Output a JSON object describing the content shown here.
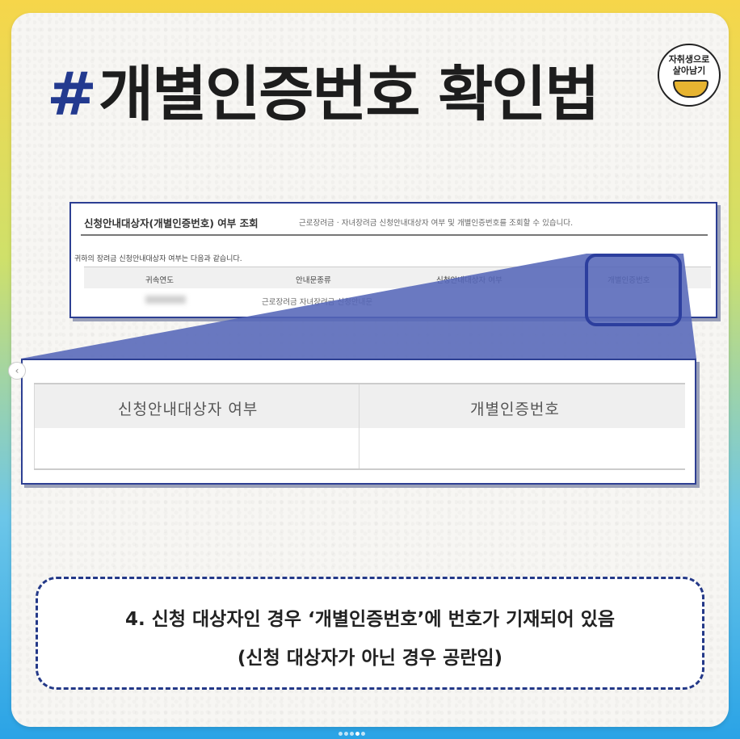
{
  "title": {
    "hash": "#",
    "text": "개별인증번호 확인법"
  },
  "logo": {
    "line1": "자취생으로",
    "line2": "살아남기"
  },
  "screenshot": {
    "heading": "신청안내대상자(개별인증번호) 여부 조회",
    "description": "근로장려금 · 자녀장려금 신청안내대상자 여부 및 개별인증번호를 조회할 수 있습니다.",
    "result_line": "귀하의 장려금 신청안내대상자 여부는 다음과 같습니다.",
    "columns": [
      "귀속연도",
      "안내문종류",
      "신청안내대상자 여부",
      "개별인증번호"
    ],
    "row": {
      "doc_type": "근로장려금 자녀장려금 신청안내문"
    }
  },
  "zoom": {
    "columns": [
      "신청안내대상자 여부",
      "개별인증번호"
    ]
  },
  "note": {
    "line1": "4. 신청 대상자인 경우 ‘개별인증번호’에 번호가 기재되어 있음",
    "line2": "(신청 대상자가 아닌 경우 공란임)"
  },
  "colors": {
    "accent": "#2d3f93",
    "highlight_fill": "#5566b8"
  },
  "icons": {
    "prev": "chevron-left-icon"
  },
  "carousel": {
    "count": 5,
    "active_index": 3
  }
}
